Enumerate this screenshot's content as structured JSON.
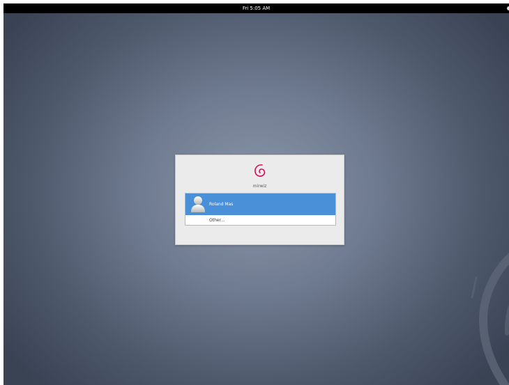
{
  "topbar": {
    "clock": "Fri  5:05 AM"
  },
  "login": {
    "hostname": "mirwiz",
    "users": [
      {
        "name": "Roland Mas",
        "selected": true,
        "avatar_icon": "default-user-avatar-icon"
      },
      {
        "name": "Other...",
        "selected": false
      }
    ],
    "logo_icon": "debian-swirl-icon"
  },
  "colors": {
    "topbar": "#000000",
    "dialog_background": "#ebebeb",
    "selection": "#4a90d9",
    "debian_red": "#d70a53"
  }
}
